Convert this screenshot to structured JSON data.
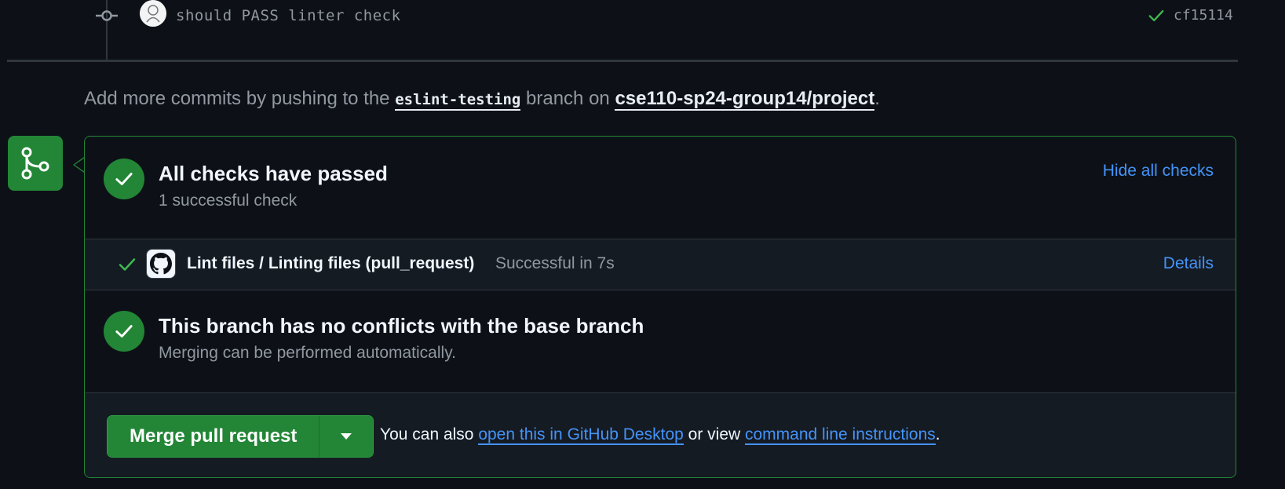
{
  "commit": {
    "message": "should PASS linter check",
    "sha": "cf15114"
  },
  "hint": {
    "prefix": "Add more commits by pushing to the ",
    "branch": "eslint-testing",
    "middle": " branch on ",
    "repo": "cse110-sp24-group14/project",
    "suffix": "."
  },
  "checks": {
    "title": "All checks have passed",
    "subtitle": "1 successful check",
    "toggle_label": "Hide all checks",
    "items": [
      {
        "name": "Lint files / Linting files (pull_request)",
        "status": "Successful in 7s",
        "details_label": "Details"
      }
    ]
  },
  "conflicts": {
    "title": "This branch has no conflicts with the base branch",
    "subtitle": "Merging can be performed automatically."
  },
  "merge": {
    "button_label": "Merge pull request",
    "hint_prefix": "You can also ",
    "desktop_link": "open this in GitHub Desktop",
    "hint_middle": " or view ",
    "cli_link": "command line instructions",
    "hint_suffix": "."
  },
  "colors": {
    "success": "#238636",
    "link": "#4493f8",
    "background": "#0d1117"
  }
}
